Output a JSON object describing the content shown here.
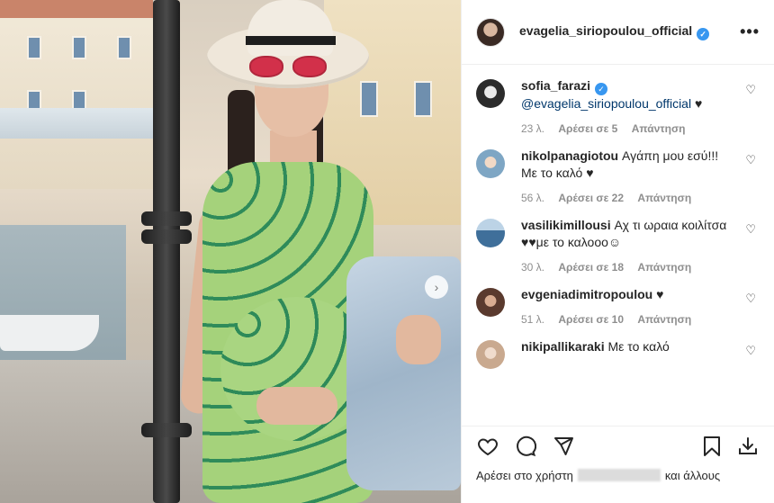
{
  "post": {
    "author": "evagelia_siriopoulou_official",
    "verified": true,
    "more_label": "•••"
  },
  "comments": [
    {
      "user": "sofia_farazi",
      "verified": true,
      "text_mention": "@evagelia_siriopoulou_official",
      "text": " ♥",
      "time": "23 λ.",
      "likes": "Αρέσει σε 5",
      "reply": "Απάντηση",
      "avatar_color": "#2b2b2b"
    },
    {
      "user": "nikolpanagiotou",
      "verified": false,
      "text": "Αγάπη μου εσύ!!! Με το καλό ♥",
      "time": "56 λ.",
      "likes": "Αρέσει σε 22",
      "reply": "Απάντηση",
      "avatar_color": "#7ea6c4"
    },
    {
      "user": "vasilikimillousi",
      "verified": false,
      "text": "Αχ τι ωραια κοιλίτσα ♥♥με το καλοοο☺",
      "time": "30 λ.",
      "likes": "Αρέσει σε 18",
      "reply": "Απάντηση",
      "avatar_color": "#3f6f9a"
    },
    {
      "user": "evgeniadimitropoulou",
      "verified": false,
      "text": " ♥",
      "time": "51 λ.",
      "likes": "Αρέσει σε 10",
      "reply": "Απάντηση",
      "avatar_color": "#5a3a2e"
    },
    {
      "user": "nikipallikaraki",
      "verified": false,
      "text": "Με το καλό",
      "time": "",
      "likes": "",
      "reply": "",
      "avatar_color": "#c9a98f"
    }
  ],
  "actions": {
    "like_icon": "heart-outline-icon",
    "comment_icon": "comment-bubble-icon",
    "share_icon": "paper-plane-icon",
    "save_icon": "bookmark-icon",
    "download_icon": "download-icon"
  },
  "likes_line": {
    "prefix": "Αρέσει στο χρήστη",
    "suffix": "και άλλους"
  },
  "colors": {
    "link": "#00376b",
    "verified": "#3897f0",
    "muted": "#8e8e8e",
    "text": "#262626"
  }
}
